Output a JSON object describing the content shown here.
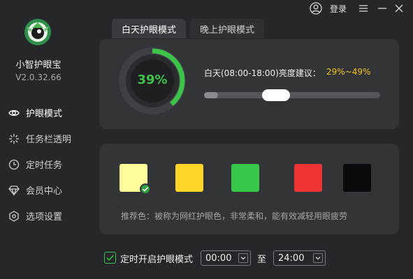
{
  "app": {
    "name": "小智护眼宝",
    "version": "V2.0.32.66"
  },
  "header": {
    "login_label": "登录"
  },
  "sidebar": {
    "items": [
      {
        "label": "护眼模式",
        "icon": "eye-icon"
      },
      {
        "label": "任务栏透明",
        "icon": "sparkle-icon"
      },
      {
        "label": "定时任务",
        "icon": "clock-icon"
      },
      {
        "label": "会员中心",
        "icon": "diamond-icon"
      },
      {
        "label": "选项设置",
        "icon": "hexagon-gear-icon"
      }
    ]
  },
  "tabs": [
    {
      "label": "白天护眼模式",
      "active": true
    },
    {
      "label": "晚上护眼模式",
      "active": false
    }
  ],
  "brightness": {
    "percent": 39,
    "display": "39%",
    "label": "白天(08:00-18:00)亮度建议：",
    "suggest_range": "29%~49%",
    "slider_value_percent": 39
  },
  "colors": {
    "swatches": [
      {
        "name": "light-yellow",
        "hex": "#fefe9a",
        "selected": true
      },
      {
        "name": "yellow",
        "hex": "#ffd627",
        "selected": false
      },
      {
        "name": "green",
        "hex": "#37c84a",
        "selected": false
      },
      {
        "name": "red",
        "hex": "#ee3434",
        "selected": false
      },
      {
        "name": "black",
        "hex": "#0a0a0b",
        "selected": false
      }
    ],
    "recommend_text": "推荐色：被称为网红护眼色，非常柔和，能有效减轻用眼疲劳"
  },
  "timer": {
    "checked": true,
    "label": "定时开启护眼模式",
    "start": "00:00",
    "to_label": "至",
    "end": "24:00"
  },
  "theme": {
    "accent": "#3ec34a",
    "warning": "#f5c518"
  }
}
